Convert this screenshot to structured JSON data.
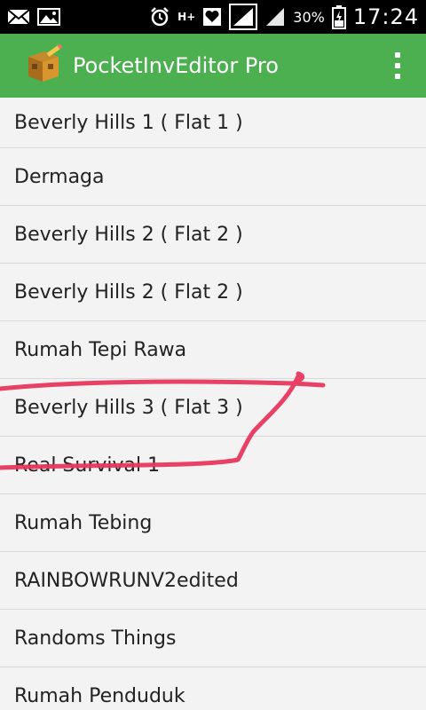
{
  "status_bar": {
    "battery_percent": "30%",
    "time": "17:24",
    "network_label": "H+",
    "icons": [
      "mail-icon",
      "image-icon",
      "alarm-icon",
      "hplus-data-icon",
      "heart-icon",
      "signal-icon",
      "signal-icon-2",
      "battery-icon"
    ]
  },
  "app_bar": {
    "title": "PocketInvEditor Pro",
    "menu_icon": "overflow-menu-icon",
    "background_color": "#4caf50"
  },
  "list": {
    "items": [
      "Beverly Hills 1 ( Flat 1 )",
      "Dermaga",
      "Beverly Hills 2 ( Flat 2 )",
      "Beverly Hills 2 ( Flat 2 )",
      "Rumah Tepi Rawa",
      "Beverly Hills 3 ( Flat 3 )",
      "Real Survival 1",
      "Rumah Tebing",
      "RAINBOWRUNV2edited",
      "Randoms Things",
      "Rumah Penduduk"
    ]
  },
  "annotation": {
    "color": "#e8365d",
    "kind": "hand-drawn-underline"
  }
}
